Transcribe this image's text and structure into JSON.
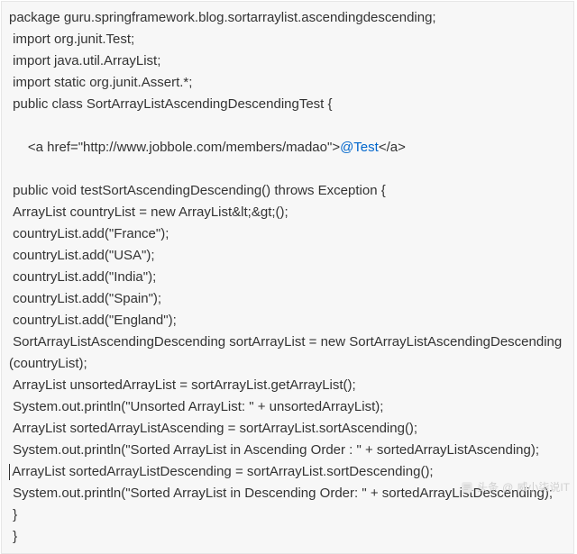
{
  "code": {
    "l1": "package guru.springframework.blog.sortarraylist.ascendingdescending;",
    "l2": " import org.junit.Test;",
    "l3": " import java.util.ArrayList;",
    "l4": " import static org.junit.Assert.*;",
    "l5": " public class SortArrayListAscendingDescendingTest {",
    "l6a": " <a href=\"http://www.jobbole.com/members/madao\">",
    "l6link": "@Test",
    "l6b": "</a>",
    "l7": " public void testSortAscendingDescending() throws Exception {",
    "l8": " ArrayList countryList = new ArrayList&lt;&gt;();",
    "l9": " countryList.add(\"France\");",
    "l10": " countryList.add(\"USA\");",
    "l11": " countryList.add(\"India\");",
    "l12": " countryList.add(\"Spain\");",
    "l13": " countryList.add(\"England\");",
    "l14": " SortArrayListAscendingDescending sortArrayList = new SortArrayListAscendingDescending(countryList);",
    "l15": " ArrayList unsortedArrayList = sortArrayList.getArrayList();",
    "l16": " System.out.println(\"Unsorted ArrayList: \" + unsortedArrayList);",
    "l17": " ArrayList sortedArrayListAscending = sortArrayList.sortAscending();",
    "l18": " System.out.println(\"Sorted ArrayList in Ascending Order : \" + sortedArrayListAscending);",
    "l19": " ArrayList sortedArrayListDescending = sortArrayList.sortDescending();",
    "l20": " System.out.println(\"Sorted ArrayList in Descending Order: \" + sortedArrayListDescending);",
    "l21": " }",
    "l22": " }"
  },
  "link": {
    "href": "http://www.jobbole.com/members/madao"
  },
  "footer": {
    "prefix": "头条",
    "at": "@",
    "author": "威小柒说IT"
  }
}
